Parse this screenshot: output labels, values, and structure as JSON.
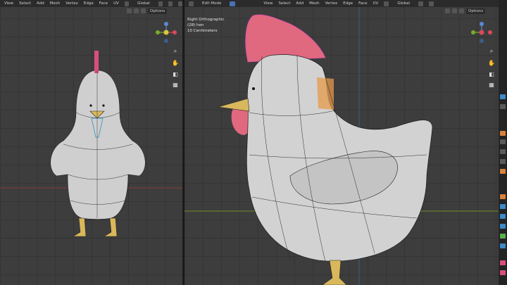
{
  "left_viewport": {
    "menu": [
      "View",
      "Select",
      "Add",
      "Mesh",
      "Vertex",
      "Edge",
      "Face",
      "UV"
    ],
    "transform_orientation": "Global",
    "options_label": "Options"
  },
  "right_viewport": {
    "mode": "Edit Mode",
    "menu": [
      "View",
      "Select",
      "Add",
      "Mesh",
      "Vertex",
      "Edge",
      "Face",
      "UV"
    ],
    "transform_orientation": "Global",
    "options_label": "Options",
    "overlay_text": {
      "view_name": "Right Orthographic",
      "object_name": "(28) hen",
      "scale": "10 Centimeters"
    }
  },
  "navigation_tools": [
    "zoom-icon",
    "hand-icon",
    "camera-icon",
    "grid-icon"
  ],
  "colors": {
    "viewport_bg": "#3d3d3d",
    "header_bg": "#2b2b2b",
    "x_axis": "#8a3a3a",
    "y_axis": "#6e8a2a",
    "z_axis": "#3a5e8a",
    "body": "#d8d8d8",
    "comb": "#e0687f",
    "beak": "#d9b85c",
    "selected_face": "#e59a4a"
  }
}
